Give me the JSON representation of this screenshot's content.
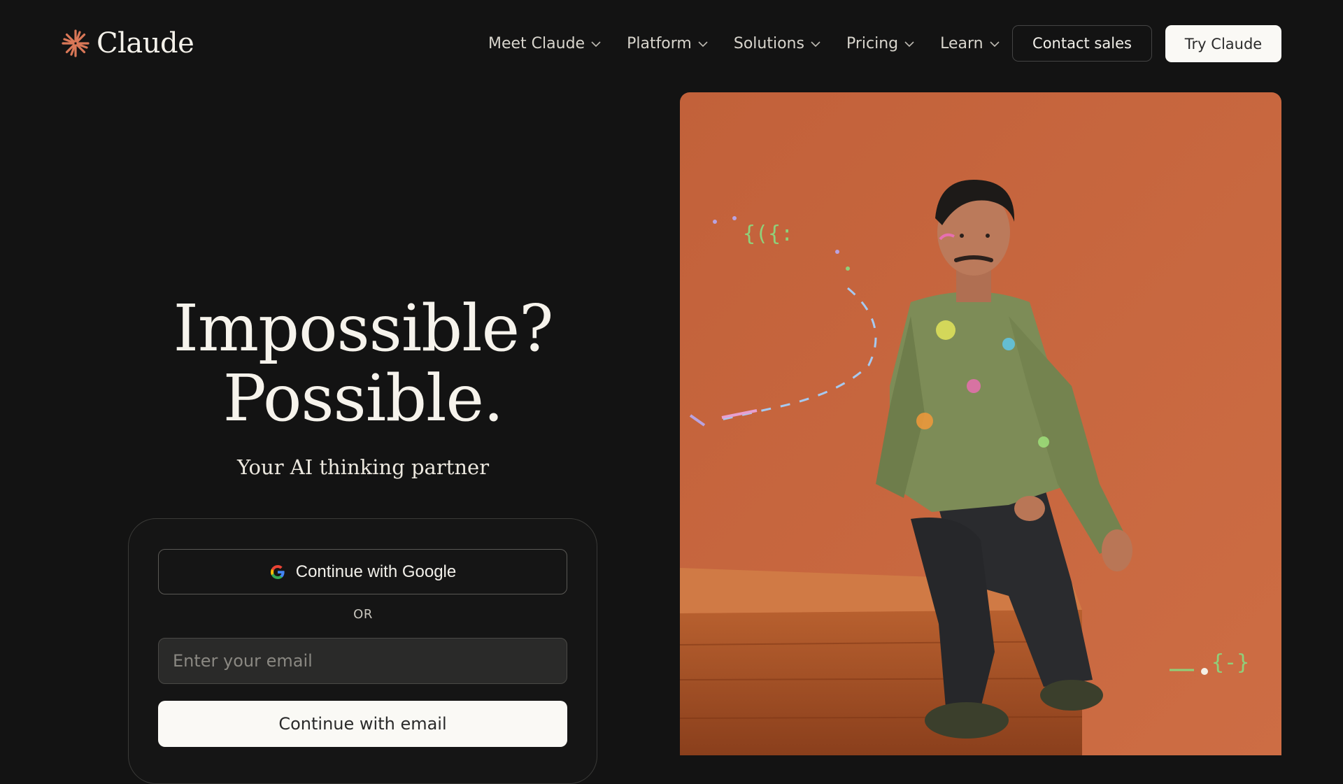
{
  "brand": {
    "name": "Claude",
    "logo_icon": "claude-spark-icon",
    "accent": "#d97757"
  },
  "nav": {
    "items": [
      {
        "label": "Meet Claude"
      },
      {
        "label": "Platform"
      },
      {
        "label": "Solutions"
      },
      {
        "label": "Pricing"
      },
      {
        "label": "Learn"
      }
    ],
    "contact_label": "Contact sales",
    "try_label": "Try Claude"
  },
  "hero": {
    "title_line1": "Impossible?",
    "title_line2": "Possible.",
    "subtitle": "Your AI thinking partner"
  },
  "auth": {
    "google_label": "Continue with Google",
    "or_label": "OR",
    "email_placeholder": "Enter your email",
    "email_button_label": "Continue with email"
  },
  "image": {
    "subject": "man in paint-splattered green jacket sitting on wooden bench against orange wall",
    "background_color": "#c6663d",
    "code_glyphs_top": "{({:",
    "code_glyphs_bottom": "{-}"
  },
  "colors": {
    "page_bg": "#131313",
    "text": "#f2f0ea",
    "button_light": "#faf9f5"
  }
}
